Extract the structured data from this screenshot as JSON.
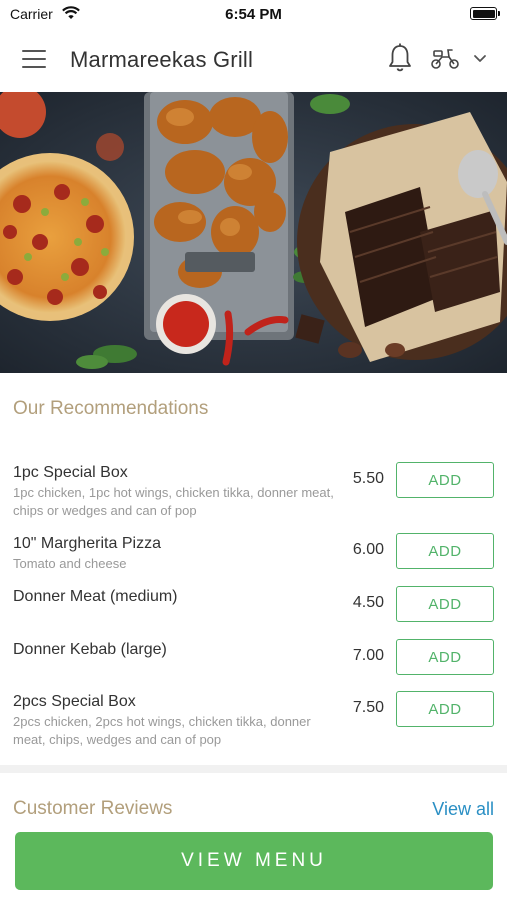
{
  "status_bar": {
    "carrier": "Carrier",
    "time": "6:54 PM"
  },
  "header": {
    "title": "Marmareekas Grill",
    "icons": [
      "hamburger-menu-icon",
      "bell-icon",
      "scooter-icon",
      "chevron-down-icon"
    ]
  },
  "hero": {
    "image": "food-banner",
    "dishes": [
      "pizza",
      "fried chicken",
      "chocolate brownies",
      "ketchup"
    ]
  },
  "recommendations": {
    "title": "Our Recommendations",
    "add_label": "ADD",
    "items": [
      {
        "name": "1pc Special Box",
        "desc": "1pc chicken, 1pc hot wings, chicken tikka, donner meat, chips or wedges and can of pop",
        "price": "5.50"
      },
      {
        "name": "10\" Margherita Pizza",
        "desc": "Tomato and cheese",
        "price": "6.00"
      },
      {
        "name": "Donner Meat (medium)",
        "desc": "",
        "price": "4.50"
      },
      {
        "name": "Donner Kebab (large)",
        "desc": "",
        "price": "7.00"
      },
      {
        "name": "2pcs Special Box",
        "desc": "2pcs chicken, 2pcs hot wings, chicken tikka, donner meat, chips, wedges and can of pop",
        "price": "7.50"
      }
    ]
  },
  "reviews": {
    "title": "Customer Reviews",
    "view_all": "View all"
  },
  "footer": {
    "view_menu": "VIEW MENU"
  },
  "colors": {
    "accent_green": "#5cb85c",
    "add_green": "#52b36a",
    "section_gold": "#b29f7c",
    "link_blue": "#2a8fc4"
  }
}
